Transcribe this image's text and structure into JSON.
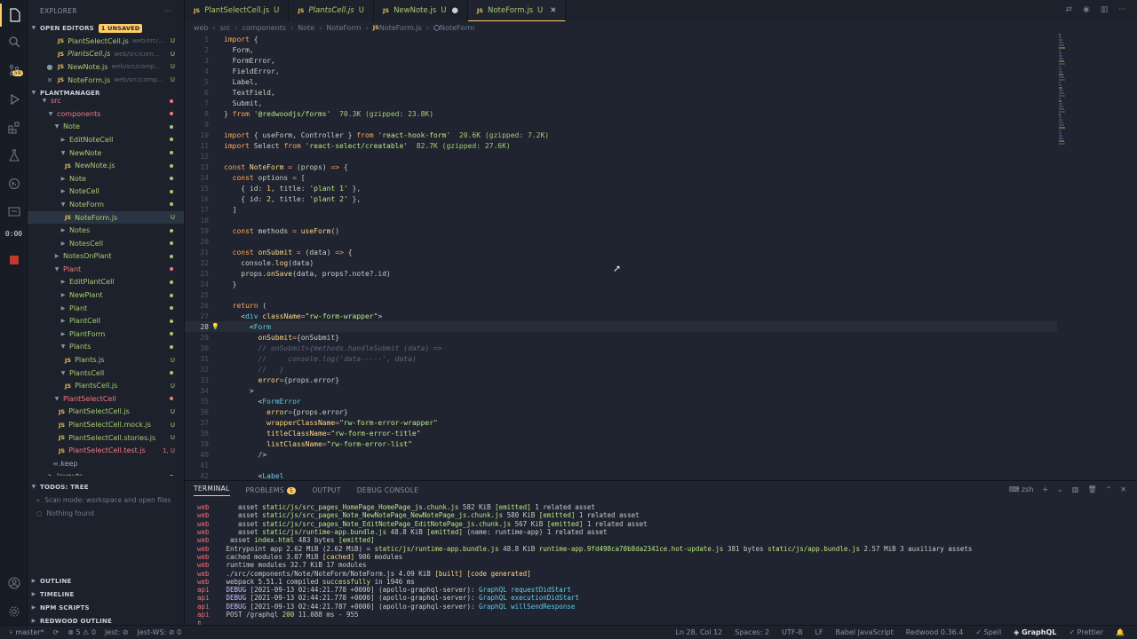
{
  "timer": "0:00",
  "activity": {
    "badge": "59"
  },
  "sidebar": {
    "title": "EXPLORER",
    "open_editors": {
      "label": "OPEN EDITORS",
      "badge": "1 UNSAVED",
      "items": [
        {
          "name": "PlantSelectCell.js",
          "path": "web/src/...",
          "status": "U",
          "italic": false,
          "lead": ""
        },
        {
          "name": "PlantsCell.js",
          "path": "web/src/com...",
          "status": "U",
          "italic": true,
          "lead": ""
        },
        {
          "name": "NewNote.js",
          "path": "web/src/comp...",
          "status": "U",
          "italic": false,
          "lead": "●"
        },
        {
          "name": "NoteForm.js",
          "path": "web/src/comp...",
          "status": "U",
          "italic": false,
          "lead": "✕"
        }
      ]
    },
    "project": {
      "label": "PLANTMANAGER"
    },
    "tree": [
      {
        "name": "src",
        "indent": 0,
        "kind": "cut",
        "red": true
      },
      {
        "name": "components",
        "indent": 1,
        "kind": "folder",
        "red": true
      },
      {
        "name": "Note",
        "indent": 2,
        "kind": "folder"
      },
      {
        "name": "EditNoteCell",
        "indent": 3,
        "kind": "folder-closed"
      },
      {
        "name": "NewNote",
        "indent": 3,
        "kind": "folder"
      },
      {
        "name": "NewNote.js",
        "indent": 4,
        "kind": "file"
      },
      {
        "name": "Note",
        "indent": 3,
        "kind": "folder-closed"
      },
      {
        "name": "NoteCell",
        "indent": 3,
        "kind": "folder-closed"
      },
      {
        "name": "NoteForm",
        "indent": 3,
        "kind": "folder"
      },
      {
        "name": "NoteForm.js",
        "indent": 4,
        "kind": "file",
        "status": "U",
        "selected": true
      },
      {
        "name": "Notes",
        "indent": 3,
        "kind": "folder-closed"
      },
      {
        "name": "NotesCell",
        "indent": 3,
        "kind": "folder-closed"
      },
      {
        "name": "NotesOnPlant",
        "indent": 2,
        "kind": "folder-closed"
      },
      {
        "name": "Plant",
        "indent": 2,
        "kind": "folder",
        "red": true
      },
      {
        "name": "EditPlantCell",
        "indent": 3,
        "kind": "folder-closed"
      },
      {
        "name": "NewPlant",
        "indent": 3,
        "kind": "folder-closed"
      },
      {
        "name": "Plant",
        "indent": 3,
        "kind": "folder-closed"
      },
      {
        "name": "PlantCell",
        "indent": 3,
        "kind": "folder-closed"
      },
      {
        "name": "PlantForm",
        "indent": 3,
        "kind": "folder-closed"
      },
      {
        "name": "Plants",
        "indent": 3,
        "kind": "folder"
      },
      {
        "name": "Plants.js",
        "indent": 4,
        "kind": "file",
        "status": "U"
      },
      {
        "name": "PlantsCell",
        "indent": 3,
        "kind": "folder"
      },
      {
        "name": "PlantsCell.js",
        "indent": 4,
        "kind": "file",
        "status": "U"
      },
      {
        "name": "PlantSelectCell",
        "indent": 2,
        "kind": "folder",
        "red": true
      },
      {
        "name": "PlantSelectCell.js",
        "indent": 3,
        "kind": "file",
        "status": "U"
      },
      {
        "name": "PlantSelectCell.mock.js",
        "indent": 3,
        "kind": "file",
        "status": "U"
      },
      {
        "name": "PlantSelectCell.stories.js",
        "indent": 3,
        "kind": "file",
        "status": "U"
      },
      {
        "name": "PlantSelectCell.test.js",
        "indent": 3,
        "kind": "file",
        "status": "1, U",
        "red": true
      },
      {
        "name": ".keep",
        "indent": 2,
        "kind": "plain"
      },
      {
        "name": "layouts",
        "indent": 1,
        "kind": "folder-closed"
      }
    ],
    "todos": {
      "label": "TODOS: TREE",
      "scan": "Scan mode: workspace and open files",
      "nothing": "Nothing found"
    },
    "bottom": [
      "OUTLINE",
      "TIMELINE",
      "NPM SCRIPTS",
      "REDWOOD OUTLINE"
    ]
  },
  "tabs": [
    {
      "name": "PlantSelectCell.js",
      "status": "U",
      "italic": false,
      "active": false
    },
    {
      "name": "PlantsCell.js",
      "status": "U",
      "italic": true,
      "active": false
    },
    {
      "name": "NewNote.js",
      "status": "U",
      "italic": false,
      "active": false,
      "dirty": true
    },
    {
      "name": "NoteForm.js",
      "status": "U",
      "italic": false,
      "active": true
    }
  ],
  "breadcrumb": [
    "web",
    "src",
    "components",
    "Note",
    "NoteForm",
    "NoteForm.js",
    "NoteForm"
  ],
  "editor": {
    "current_line": 28,
    "lines": [
      [
        [
          "kw",
          "import"
        ],
        [
          "pn",
          " {"
        ]
      ],
      [
        [
          "pn",
          "  Form,"
        ]
      ],
      [
        [
          "pn",
          "  FormError,"
        ]
      ],
      [
        [
          "pn",
          "  FieldError,"
        ]
      ],
      [
        [
          "pn",
          "  Label,"
        ]
      ],
      [
        [
          "pn",
          "  TextField,"
        ]
      ],
      [
        [
          "pn",
          "  Submit,"
        ]
      ],
      [
        [
          "pn",
          "} "
        ],
        [
          "kw",
          "from"
        ],
        [
          "str",
          " '@redwoodjs/forms'"
        ],
        [
          "sz",
          "  70.3K (gzipped: 23.8K)"
        ]
      ],
      [],
      [
        [
          "kw",
          "import"
        ],
        [
          "pn",
          " { useForm, Controller } "
        ],
        [
          "kw",
          "from"
        ],
        [
          "str",
          " 'react-hook-form'"
        ],
        [
          "sz",
          "  20.6K (gzipped: 7.2K)"
        ]
      ],
      [
        [
          "kw",
          "import"
        ],
        [
          "pn",
          " Select "
        ],
        [
          "kw",
          "from"
        ],
        [
          "str",
          " 'react-select/creatable'"
        ],
        [
          "sz",
          "  82.7K (gzipped: 27.6K)"
        ]
      ],
      [],
      [
        [
          "kw",
          "const"
        ],
        [
          "fn",
          " NoteForm"
        ],
        [
          "op",
          " ="
        ],
        [
          "pn",
          " (props) "
        ],
        [
          "op",
          "=>"
        ],
        [
          "pn",
          " {"
        ]
      ],
      [
        [
          "kw",
          "  const"
        ],
        [
          "pn",
          " options "
        ],
        [
          "op",
          "="
        ],
        [
          "pn",
          " ["
        ]
      ],
      [
        [
          "pn",
          "    { id: "
        ],
        [
          "num",
          "1"
        ],
        [
          "pn",
          ", title: "
        ],
        [
          "str",
          "'plant 1'"
        ],
        [
          "pn",
          " },"
        ]
      ],
      [
        [
          "pn",
          "    { id: "
        ],
        [
          "num",
          "2"
        ],
        [
          "pn",
          ", title: "
        ],
        [
          "str",
          "'plant 2'"
        ],
        [
          "pn",
          " },"
        ]
      ],
      [
        [
          "pn",
          "  ]"
        ]
      ],
      [],
      [
        [
          "kw",
          "  const"
        ],
        [
          "pn",
          " methods "
        ],
        [
          "op",
          "="
        ],
        [
          "fn",
          " useForm"
        ],
        [
          "pn",
          "()"
        ]
      ],
      [],
      [
        [
          "kw",
          "  const"
        ],
        [
          "fn",
          " onSubmit"
        ],
        [
          "op",
          " ="
        ],
        [
          "pn",
          " (data) "
        ],
        [
          "op",
          "=>"
        ],
        [
          "pn",
          " {"
        ]
      ],
      [
        [
          "pn",
          "    console."
        ],
        [
          "fn",
          "log"
        ],
        [
          "pn",
          "(data)"
        ]
      ],
      [
        [
          "pn",
          "    props."
        ],
        [
          "fn",
          "onSave"
        ],
        [
          "pn",
          "(data, props?.note?.id)"
        ]
      ],
      [
        [
          "pn",
          "  }"
        ]
      ],
      [],
      [
        [
          "kw",
          "  return"
        ],
        [
          "pn",
          " ("
        ]
      ],
      [
        [
          "pn",
          "    <"
        ],
        [
          "tag",
          "div"
        ],
        [
          "at",
          " className"
        ],
        [
          "op",
          "="
        ],
        [
          "str",
          "\"rw-form-wrapper\""
        ],
        [
          "pn",
          ">"
        ]
      ],
      [
        [
          "pn",
          "      <"
        ],
        [
          "tag",
          "Form"
        ]
      ],
      [
        [
          "at",
          "        onSubmit"
        ],
        [
          "op",
          "="
        ],
        [
          "pn",
          "{onSubmit}"
        ]
      ],
      [
        [
          "cm",
          "        // onSubmit={methods.handleSubmit (data) =>"
        ]
      ],
      [
        [
          "cm",
          "        //     console.log('data-----', data)"
        ]
      ],
      [
        [
          "cm",
          "        //   }"
        ]
      ],
      [
        [
          "at",
          "        error"
        ],
        [
          "op",
          "="
        ],
        [
          "pn",
          "{props.error}"
        ]
      ],
      [
        [
          "pn",
          "      >"
        ]
      ],
      [
        [
          "pn",
          "        <"
        ],
        [
          "tag",
          "FormError"
        ]
      ],
      [
        [
          "at",
          "          error"
        ],
        [
          "op",
          "="
        ],
        [
          "pn",
          "{props.error}"
        ]
      ],
      [
        [
          "at",
          "          wrapperClassName"
        ],
        [
          "op",
          "="
        ],
        [
          "str",
          "\"rw-form-error-wrapper\""
        ]
      ],
      [
        [
          "at",
          "          titleClassName"
        ],
        [
          "op",
          "="
        ],
        [
          "str",
          "\"rw-form-error-title\""
        ]
      ],
      [
        [
          "at",
          "          listClassName"
        ],
        [
          "op",
          "="
        ],
        [
          "str",
          "\"rw-form-error-list\""
        ]
      ],
      [
        [
          "pn",
          "        />"
        ]
      ],
      [],
      [
        [
          "pn",
          "        <"
        ],
        [
          "tag",
          "Label"
        ]
      ]
    ]
  },
  "panel": {
    "tabs": [
      "TERMINAL",
      "PROBLEMS",
      "OUTPUT",
      "DEBUG CONSOLE"
    ],
    "problems_count": "5",
    "shell": "zsh",
    "lines": [
      [
        [
          "pre",
          "web"
        ],
        [
          "pn",
          "    asset "
        ],
        [
          "t-grn",
          "static/js/src_pages_HomePage_HomePage_js.chunk.js"
        ],
        [
          "pn",
          " 582 KiB "
        ],
        [
          "t-grn",
          "[emitted]"
        ],
        [
          "pn",
          " 1 related asset"
        ]
      ],
      [
        [
          "pre",
          "web"
        ],
        [
          "pn",
          "    asset "
        ],
        [
          "t-grn",
          "static/js/src_pages_Note_NewNotePage_NewNotePage_js.chunk.js"
        ],
        [
          "pn",
          " 580 KiB "
        ],
        [
          "t-grn",
          "[emitted]"
        ],
        [
          "pn",
          " 1 related asset"
        ]
      ],
      [
        [
          "pre",
          "web"
        ],
        [
          "pn",
          "    asset "
        ],
        [
          "t-grn",
          "static/js/src_pages_Note_EditNotePage_EditNotePage_js.chunk.js"
        ],
        [
          "pn",
          " 567 KiB "
        ],
        [
          "t-grn",
          "[emitted]"
        ],
        [
          "pn",
          " 1 related asset"
        ]
      ],
      [
        [
          "pre",
          "web"
        ],
        [
          "pn",
          "    asset "
        ],
        [
          "t-grn",
          "static/js/runtime-app.bundle.js"
        ],
        [
          "pn",
          " 48.8 KiB "
        ],
        [
          "t-grn",
          "[emitted]"
        ],
        [
          "pn",
          " (name: runtime-app) 1 related asset"
        ]
      ],
      [
        [
          "pre",
          "web"
        ],
        [
          "pn",
          "  asset "
        ],
        [
          "t-grn",
          "index.html"
        ],
        [
          "pn",
          " 483 bytes "
        ],
        [
          "t-grn",
          "[emitted]"
        ]
      ],
      [
        [
          "pre",
          "web"
        ],
        [
          "pn",
          " Entrypoint app 2.62 MiB (2.62 MiB) = "
        ],
        [
          "t-grn",
          "static/js/runtime-app.bundle.js"
        ],
        [
          "pn",
          " 48.8 KiB "
        ],
        [
          "t-grn",
          "runtime-app.9fd498ca70b8da2341ce.hot-update.js"
        ],
        [
          "pn",
          " 381 bytes "
        ],
        [
          "t-grn",
          "static/js/app.bundle.js"
        ],
        [
          "pn",
          " 2.57 MiB 3 auxiliary assets"
        ]
      ],
      [
        [
          "pre",
          "web"
        ],
        [
          "pn",
          " cached modules 3.07 MiB "
        ],
        [
          "t-yel",
          "[cached]"
        ],
        [
          "pn",
          " 906 modules"
        ]
      ],
      [
        [
          "pre",
          "web"
        ],
        [
          "pn",
          " runtime modules 32.7 KiB 17 modules"
        ]
      ],
      [
        [
          "pre",
          "web"
        ],
        [
          "pn",
          " ./src/components/Note/NoteForm/NoteForm.js 4.09 KiB "
        ],
        [
          "t-yel",
          "[built] [code generated]"
        ]
      ],
      [
        [
          "pre",
          "web"
        ],
        [
          "pn",
          " webpack 5.51.1 compiled "
        ],
        [
          "t-grn",
          "successfully"
        ],
        [
          "pn",
          " in 1946 ms"
        ]
      ],
      [
        [
          "pre",
          "api"
        ],
        [
          "pn",
          " "
        ],
        [
          "t-mag",
          "DEBUG"
        ],
        [
          "pn",
          " [2021-09-13 02:44:21.778 +0000] (apollo-graphql-server): "
        ],
        [
          "t-cy",
          "GraphQL requestDidStart"
        ]
      ],
      [
        [
          "pre",
          "api"
        ],
        [
          "pn",
          " "
        ],
        [
          "t-mag",
          "DEBUG"
        ],
        [
          "pn",
          " [2021-09-13 02:44:21.778 +0000] (apollo-graphql-server): "
        ],
        [
          "t-cy",
          "GraphQL executionDidStart"
        ]
      ],
      [
        [
          "pre",
          "api"
        ],
        [
          "pn",
          " "
        ],
        [
          "t-mag",
          "DEBUG"
        ],
        [
          "pn",
          " [2021-09-13 02:44:21.787 +0000] (apollo-graphql-server): "
        ],
        [
          "t-cy",
          "GraphQL willSendResponse"
        ]
      ],
      [
        [
          "pre",
          "api"
        ],
        [
          "pn",
          " POST /graphql "
        ],
        [
          "t-grn",
          "200"
        ],
        [
          "pn",
          " 11.088 ms - 955"
        ]
      ]
    ]
  },
  "status": {
    "branch": "master*",
    "sync": "⟳",
    "errors": "5",
    "warnings": "0",
    "jest": "Jest: ",
    "jestws": "Jest-WS: ",
    "jestws_count": "0",
    "position": "Ln 28, Col 12",
    "spaces": "Spaces: 2",
    "encoding": "UTF-8",
    "eol": "LF",
    "language": "Babel JavaScript",
    "redwood": "Redwood 0.36.4",
    "spell": "Spell",
    "graphql": "GraphQL",
    "prettier": "Prettier"
  }
}
